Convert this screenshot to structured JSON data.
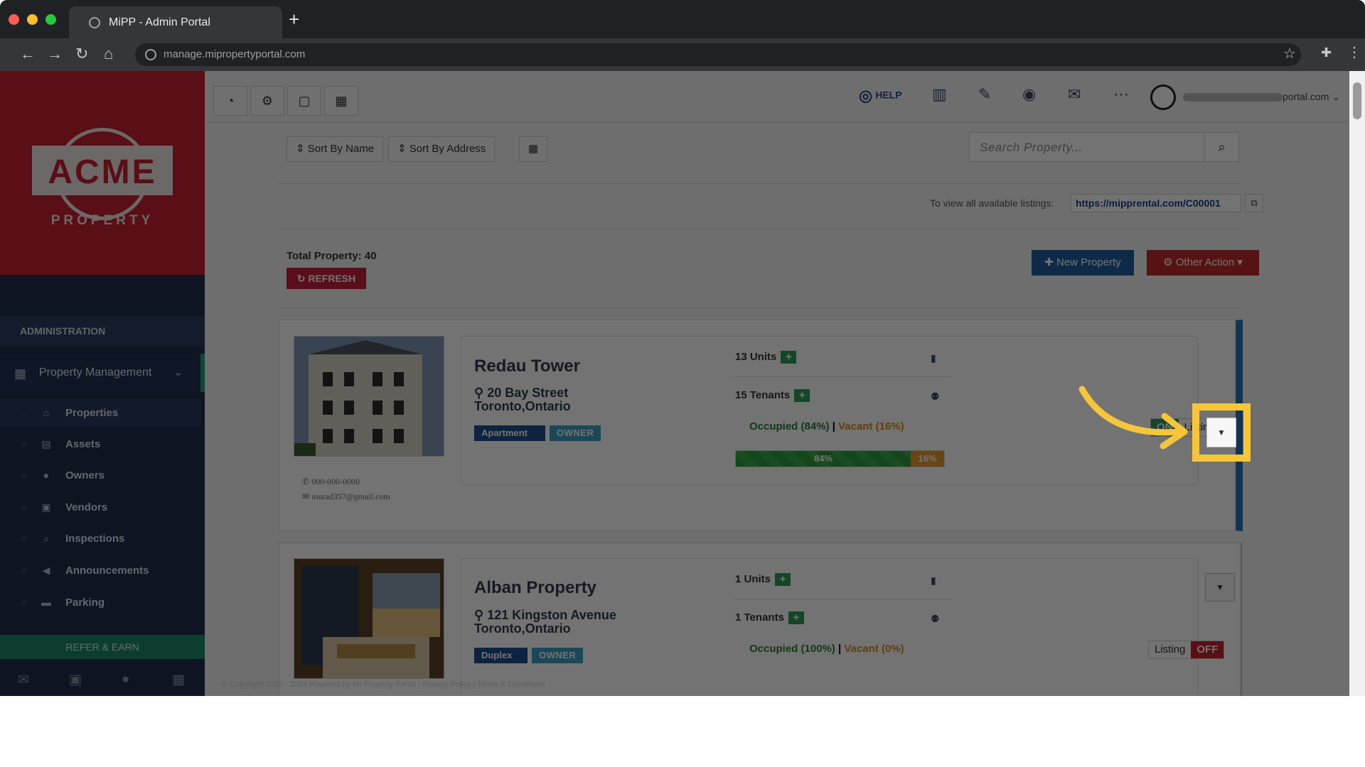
{
  "browser": {
    "tab_title": "MiPP - Admin Portal",
    "url": "manage.mipropertyportal.com"
  },
  "brand": {
    "logo_word": "ACME",
    "logo_sub": "PROPERTY",
    "accent": "#c8202f"
  },
  "sidebar": {
    "section_title": "ADMINISTRATION",
    "group_label": "Property Management",
    "items": [
      {
        "label": "Properties",
        "icon": "home-icon"
      },
      {
        "label": "Assets",
        "icon": "archive-icon"
      },
      {
        "label": "Owners",
        "icon": "user-icon"
      },
      {
        "label": "Vendors",
        "icon": "briefcase-icon"
      },
      {
        "label": "Inspections",
        "icon": "magnifier-icon"
      },
      {
        "label": "Announcements",
        "icon": "megaphone-icon"
      },
      {
        "label": "Parking",
        "icon": "car-icon"
      }
    ],
    "refer_label": "REFER & EARN"
  },
  "header": {
    "help_label": "HELP",
    "user_email_suffix": "portal.com"
  },
  "toolbar": {
    "sort_name": "Sort By Name",
    "sort_address": "Sort By Address",
    "search_placeholder": "Search Property...",
    "listing_text": "To view all available listings:",
    "listing_url": "https://mipprental.com/C00001",
    "total_label": "Total Property: 40",
    "refresh_label": "REFRESH",
    "new_property_label": "New Property",
    "other_action_label": "Other Action"
  },
  "properties": [
    {
      "name": "Redau Tower",
      "address_line1": "20 Bay Street",
      "address_line2": "Toronto,Ontario",
      "type": "Apartment",
      "role": "OWNER",
      "units": "13 Units",
      "tenants": "15 Tenants",
      "occupied": "Occupied (84%)",
      "vacant": "Vacant (16%)",
      "occupied_pct": 84,
      "occupied_label": "84%",
      "vacant_label": "16%",
      "phone": "000-000-0000",
      "email": "murad357@gmail.com",
      "listing_on": "ON",
      "listing_label": "Listing"
    },
    {
      "name": "Alban Property",
      "address_line1": "121 Kingston Avenue",
      "address_line2": "Toronto,Ontario",
      "type": "Duplex",
      "role": "OWNER",
      "units": "1 Units",
      "tenants": "1 Tenants",
      "occupied": "Occupied (100%)",
      "vacant": "Vacant (0%)",
      "listing_label": "Listing",
      "listing_off": "OFF"
    }
  ],
  "footer": {
    "text": "© Copyright 2016 - 2024 Powered by MI Property Portal | Privacy Policy | Terms & Conditions"
  }
}
